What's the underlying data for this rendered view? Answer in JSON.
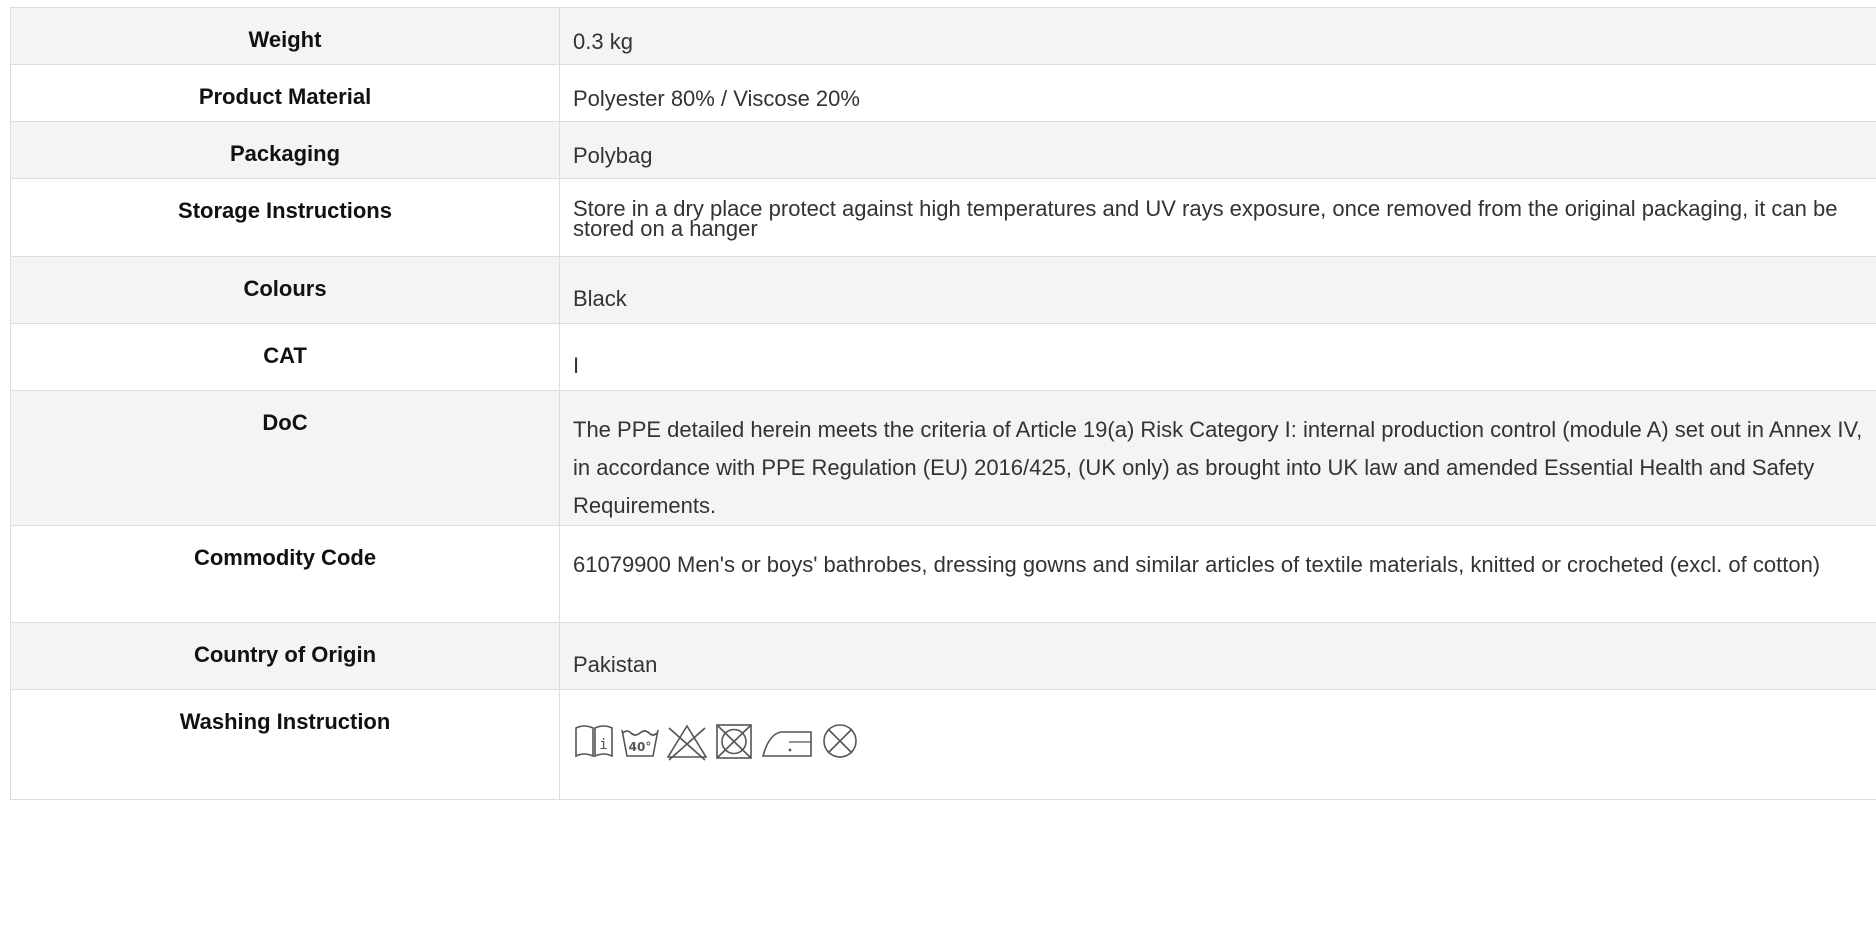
{
  "rows": [
    {
      "label": "Weight",
      "value": "0.3 kg"
    },
    {
      "label": "Product Material",
      "value": "Polyester 80% / Viscose 20%"
    },
    {
      "label": "Packaging",
      "value": "Polybag"
    },
    {
      "label": "Storage Instructions",
      "value": "Store in a dry place protect against high temperatures and UV rays exposure, once removed from the original packaging, it can be stored on a hanger"
    },
    {
      "label": "Colours",
      "value": "Black"
    },
    {
      "label": "CAT",
      "value": "I"
    },
    {
      "label": "DoC",
      "value": "The PPE detailed herein meets the criteria of Article 19(a) Risk Category I: internal production control (module A) set out in Annex IV, in accordance with PPE Regulation (EU) 2016/425, (UK only) as brought into UK law and amended Essential Health and Safety Requirements."
    },
    {
      "label": "Commodity Code",
      "value": "61079900 Men's or boys' bathrobes, dressing gowns and similar articles of textile materials, knitted or crocheted (excl. of cotton)"
    },
    {
      "label": "Country of Origin",
      "value": "Pakistan"
    },
    {
      "label": "Washing Instruction",
      "value": ""
    }
  ],
  "care_symbols": {
    "read_instructions_icon_text": "i",
    "wash_temperature": "40°",
    "icons": [
      "read-instructions-icon",
      "wash-40-icon",
      "do-not-bleach-icon",
      "do-not-tumble-dry-icon",
      "iron-low-heat-icon",
      "do-not-dry-clean-icon"
    ]
  },
  "colors": {
    "border": "#dddddd",
    "shaded_row": "#f4f4f4",
    "text": "#333333"
  }
}
